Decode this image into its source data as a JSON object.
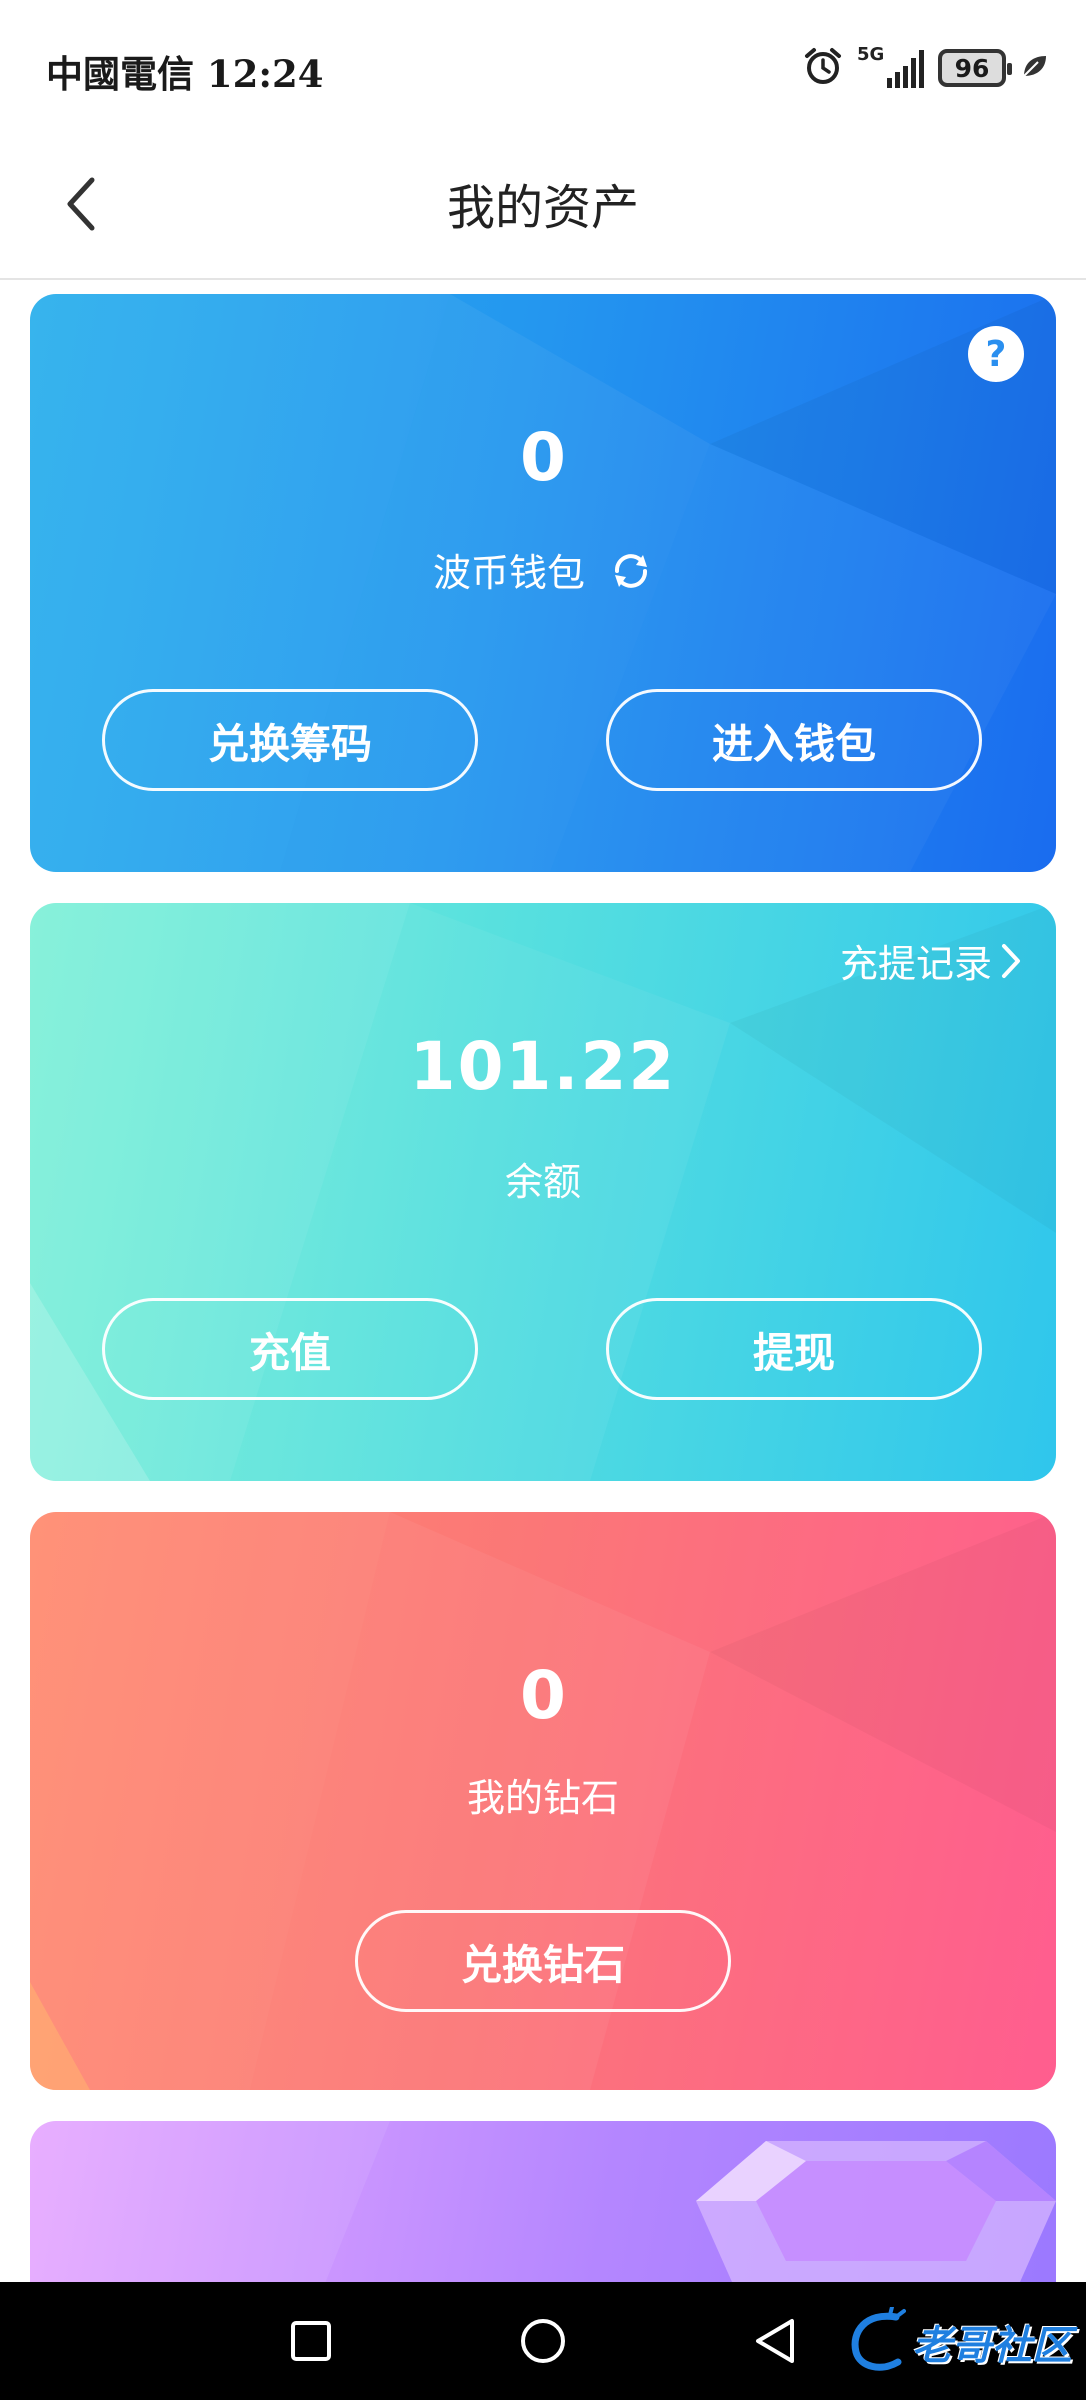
{
  "status_bar": {
    "carrier": "中國電信 12:24",
    "network": "5G",
    "battery": "96"
  },
  "header": {
    "title": "我的资产",
    "back_icon": "chevron-left-icon"
  },
  "wallet_card": {
    "amount": "0",
    "label": "波币钱包",
    "refresh_icon": "refresh-icon",
    "help_icon": "question-icon",
    "help_text": "?",
    "buttons": [
      "兑换筹码",
      "进入钱包"
    ],
    "colors": [
      "#2bb0ec",
      "#1a6cef"
    ]
  },
  "balance_card": {
    "amount": "101.22",
    "label": "余额",
    "record_link": "充提记录",
    "buttons": [
      "充值",
      "提现"
    ],
    "colors": [
      "#7bf0d6",
      "#2fc6ec"
    ]
  },
  "diamond_card": {
    "amount": "0",
    "label": "我的钻石",
    "button": "兑换钻石",
    "colors": [
      "#ff8a6e",
      "#ff5d8f"
    ]
  },
  "purple_card": {
    "icon": "gem-icon",
    "colors": [
      "#e6a8ff",
      "#9a78ff"
    ]
  },
  "nav_bar": {
    "icons": [
      "square-icon",
      "circle-icon",
      "triangle-back-icon"
    ],
    "watermark": "老哥社区"
  }
}
